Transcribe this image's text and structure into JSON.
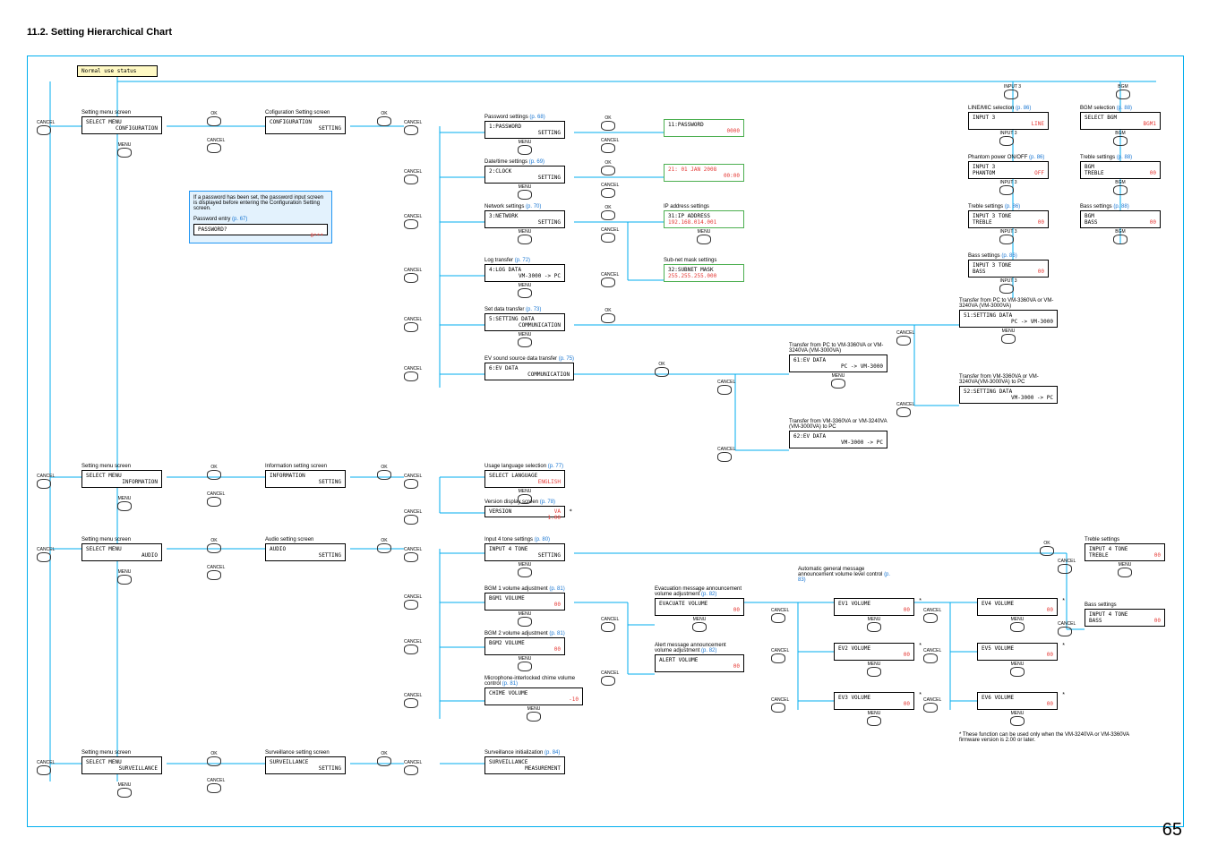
{
  "title": "11.2. Setting Hierarchical Chart",
  "page": "65",
  "normal": "Normal use status",
  "btns": {
    "menu": "MENU",
    "ok": "OK",
    "cancel": "CANCEL",
    "input3": "INPUT 3",
    "bgm": "BGM"
  },
  "note": {
    "text": "If a password has been set, the password input screen is displayed before entering the Configuration Setting screen.",
    "pwlbl": "Password entry",
    "pwref": "(p. 67)",
    "pwbox1": "PASSWORD?",
    "pwbox2": "0***"
  },
  "sm": {
    "lbl": "Setting menu screen",
    "l1": "SELECT MENU",
    "conf": "CONFIGURATION",
    "info": "INFORMATION",
    "audio": "AUDIO",
    "surv": "SURVEILLANCE"
  },
  "conf": {
    "lbl": "Cofiguration Setting screen",
    "l1": "CONFIGURATION",
    "l2": "SETTING"
  },
  "pw": {
    "lbl": "Password settings",
    "ref": "(p. 68)",
    "l1": "1:PASSWORD",
    "l2": "SETTING",
    "r1": "11:PASSWORD",
    "r2": "0000"
  },
  "clk": {
    "lbl": "Date/time settings",
    "ref": "(p. 69)",
    "l1": "2:CLOCK",
    "l2": "SETTING",
    "r1": "21: 01 JAN 2008",
    "r2": "00:00"
  },
  "net": {
    "lbl": "Network settings",
    "ref": "(p. 70)",
    "l1": "3:NETWORK",
    "l2": "SETTING",
    "iplbl": "IP address settings",
    "ip1": "31:IP ADDRESS",
    "ip2": "192.168.014.001",
    "smlbl": "Sub-net mask settings",
    "sm1": "32:SUBNET MASK",
    "sm2": "255.255.255.000"
  },
  "log": {
    "lbl": "Log transfer",
    "ref": "(p. 72)",
    "l1": "4:LOG DATA",
    "l2": "VM-3000 -> PC"
  },
  "sdt": {
    "lbl": "Set data transfer",
    "ref": "(p. 73)",
    "l1": "5:SETTING DATA",
    "l2": "COMMUNICATION"
  },
  "ev": {
    "lbl": "EV sound source data transfer",
    "ref": "(p. 75)",
    "l1": "6:EV DATA",
    "l2": "COMMUNICATION"
  },
  "sdt1": {
    "lbl": "Transfer from PC to VM-3360VA or VM-3240VA (VM-3000VA)",
    "l1": "51:SETTING DATA",
    "l2": "PC -> VM-3000"
  },
  "sdt2": {
    "lbl": "Transfer from VM-3360VA or VM-3240VA(VM-3000VA) to PC",
    "l1": "52:SETTING DATA",
    "l2": "VM-3000 -> PC"
  },
  "ev1": {
    "lbl": "Transfer from PC to VM-3360VA or VM-3240VA (VM-3000VA)",
    "l1": "61:EV DATA",
    "l2": "PC -> VM-3000"
  },
  "ev2": {
    "lbl": "Transfer from VM-3360VA or VM-3240VA (VM-3000VA) to PC",
    "l1": "62:EV DATA",
    "l2": "VM-3000 -> PC"
  },
  "info": {
    "lbl": "Information setting screen",
    "l1": "INFORMATION",
    "l2": "SETTING"
  },
  "lang": {
    "lbl": "Usage language selection",
    "ref": "(p. 77)",
    "l1": "SELECT LANGUAGE",
    "l2": "ENGLISH"
  },
  "ver": {
    "lbl": "Version display screen",
    "ref": "(p. 78)",
    "l1": "VERSION",
    "l2": "VA",
    "l3": "1.00"
  },
  "in3": {
    "linelbl": "LINE/MIC selection",
    "lineref": "(p. 86)",
    "line1": "INPUT 3",
    "line2": "LINE",
    "phlbl": "Phantom power ON/OFF",
    "phref": "(p. 86)",
    "ph1": "INPUT 3",
    "ph2": "PHANTOM",
    "ph3": "OFF",
    "trlbl": "Treble settings",
    "trref": "(p. 86)",
    "tr1": "INPUT 3 TONE",
    "tr2": "TREBLE",
    "tr3": "00",
    "balbl": "Bass settings",
    "baref": "(p. 86)",
    "ba1": "INPUT 3 TONE",
    "ba2": "BASS",
    "ba3": "00"
  },
  "bgm": {
    "sellbl": "BGM selection",
    "selref": "(p. 88)",
    "sel1": "SELECT BGM",
    "sel2": "BGM1",
    "trlbl": "Treble settings",
    "trref": "(p. 88)",
    "tr1": "BGM",
    "tr2": "TREBLE",
    "tr3": "00",
    "balbl": "Bass settings",
    "baref": "(p. 88)",
    "ba1": "BGM",
    "ba2": "BASS",
    "ba3": "00"
  },
  "audio": {
    "lbl": "Audio setting screen",
    "l1": "AUDIO",
    "l2": "SETTING"
  },
  "in4": {
    "lbl": "Input 4 tone settings",
    "ref": "(p. 80)",
    "l1": "INPUT 4 TONE",
    "l2": "SETTING",
    "trlbl": "Treble settings",
    "tr1": "INPUT 4 TONE",
    "tr2": "TREBLE",
    "tr3": "00",
    "balbl": "Bass settings",
    "ba1": "INPUT 4 TONE",
    "ba2": "BASS",
    "ba3": "00"
  },
  "bgm1": {
    "lbl": "BGM 1 volume adjustment",
    "ref": "(p. 81)",
    "l1": "BGM1 VOLUME",
    "l2": "00"
  },
  "bgm2": {
    "lbl": "BGM 2 volume adjustment",
    "ref": "(p. 81)",
    "l1": "BGM2 VOLUME",
    "l2": "00"
  },
  "chime": {
    "lbl": "Microphone-interlocked chime volume control",
    "ref": "(p. 81)",
    "l1": "CHIME VOLUME",
    "l2": "-10"
  },
  "evac": {
    "lbl": "Evacuation message announcement volume adjustment",
    "ref": "(p. 82)",
    "l1": "EVACUATE VOLUME",
    "l2": "00"
  },
  "alert": {
    "lbl": "Alert message announcement volume adjustment",
    "ref": "(p. 82)",
    "l1": "ALERT VOLUME",
    "l2": "00"
  },
  "agm": {
    "lbl": "Automatic general message announcement volume level control",
    "ref": "(p. 83)"
  },
  "evv": {
    "1": "EV1 VOLUME",
    "2": "EV2 VOLUME",
    "3": "EV3 VOLUME",
    "4": "EV4 VOLUME",
    "5": "EV5 VOLUME",
    "6": "EV6 VOLUME",
    "val": "00"
  },
  "surv": {
    "lbl": "Surveillance setting screen",
    "l1": "SURVEILLANCE",
    "l2": "SETTING",
    "initlbl": "Surveillance initialization",
    "initref": "(p. 84)",
    "init1": "SURVEILLANCE",
    "init2": "MEASUREMENT"
  },
  "footnote": "* These function can be used only when the VM-3240VA or VM-3360VA firmware version is 2.00 or later."
}
